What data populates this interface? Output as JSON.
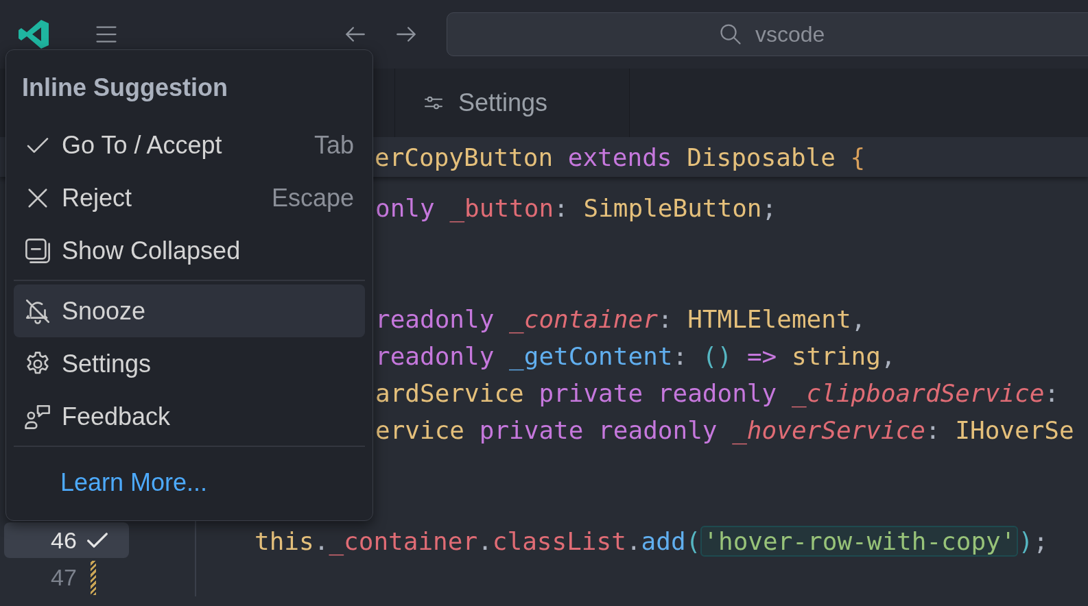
{
  "titlebar": {
    "command_center": "vscode"
  },
  "tabs": [
    {
      "label": "Settings",
      "selected": false
    }
  ],
  "editor": {
    "sticky": {
      "tokens": [
        {
          "text": "erCopyButton",
          "kind": "type"
        },
        {
          "text": " extends",
          "kind": "keyword"
        },
        {
          "text": " Disposable",
          "kind": "type"
        },
        {
          "text": " {",
          "kind": "brace"
        }
      ]
    },
    "lines": [
      {
        "kind": "covered",
        "tokens": [
          {
            "text": "only",
            "kind": "keyword"
          },
          {
            "text": " _button",
            "kind": "variable"
          },
          {
            "text": ": ",
            "kind": "punct"
          },
          {
            "text": "SimpleButton",
            "kind": "type"
          },
          {
            "text": ";",
            "kind": "punct"
          }
        ]
      },
      {
        "kind": "blank"
      },
      {
        "kind": "blank"
      },
      {
        "kind": "covered",
        "tokens": [
          {
            "text": "readonly",
            "kind": "keyword"
          },
          {
            "text": " _container",
            "kind": "parameter"
          },
          {
            "text": ": ",
            "kind": "punct"
          },
          {
            "text": "HTMLElement",
            "kind": "type"
          },
          {
            "text": ",",
            "kind": "punct"
          }
        ]
      },
      {
        "kind": "covered",
        "tokens": [
          {
            "text": "readonly",
            "kind": "keyword"
          },
          {
            "text": " _getContent",
            "kind": "function"
          },
          {
            "text": ": ",
            "kind": "punct"
          },
          {
            "text": "()",
            "kind": "paren"
          },
          {
            "text": " =>",
            "kind": "keyword"
          },
          {
            "text": " string",
            "kind": "type"
          },
          {
            "text": ",",
            "kind": "punct"
          }
        ]
      },
      {
        "kind": "covered",
        "tokens": [
          {
            "text": "ardService",
            "kind": "type"
          },
          {
            "text": " private",
            "kind": "keyword"
          },
          {
            "text": " readonly",
            "kind": "keyword"
          },
          {
            "text": " _clipboardService",
            "kind": "parameter"
          },
          {
            "text": ":",
            "kind": "punct"
          }
        ]
      },
      {
        "kind": "covered",
        "tokens": [
          {
            "text": "ervice",
            "kind": "type"
          },
          {
            "text": " private",
            "kind": "keyword"
          },
          {
            "text": " readonly",
            "kind": "keyword"
          },
          {
            "text": " _hoverService",
            "kind": "parameter"
          },
          {
            "text": ": ",
            "kind": "punct"
          },
          {
            "text": "IHoverSe",
            "kind": "type"
          }
        ]
      },
      {
        "kind": "blank"
      },
      {
        "kind": "blank"
      },
      {
        "kind": "full",
        "number": "46",
        "current": true,
        "modified": false,
        "tokens": [
          {
            "text": "this",
            "kind": "type"
          },
          {
            "text": ".",
            "kind": "punct"
          },
          {
            "text": "_container",
            "kind": "variable"
          },
          {
            "text": ".",
            "kind": "punct"
          },
          {
            "text": "classList",
            "kind": "variable"
          },
          {
            "text": ".",
            "kind": "punct"
          },
          {
            "text": "add",
            "kind": "function"
          },
          {
            "text": "(",
            "kind": "paren"
          },
          {
            "text": "'hover-row-with-copy'",
            "kind": "matched-string"
          },
          {
            "text": ")",
            "kind": "paren"
          },
          {
            "text": ";",
            "kind": "punct"
          }
        ]
      },
      {
        "kind": "full",
        "number": "47",
        "current": false,
        "modified": true
      }
    ]
  },
  "menu": {
    "title": "Inline Suggestion",
    "items": [
      {
        "kind": "item",
        "label": "Go To / Accept",
        "shortcut": "Tab",
        "selected": false
      },
      {
        "kind": "item",
        "label": "Reject",
        "shortcut": "Escape",
        "selected": false
      },
      {
        "kind": "item",
        "label": "Show Collapsed",
        "selected": false
      },
      {
        "kind": "separator"
      },
      {
        "kind": "item",
        "label": "Snooze",
        "selected": true
      },
      {
        "kind": "item",
        "label": "Settings",
        "selected": false
      },
      {
        "kind": "item",
        "label": "Feedback",
        "selected": false
      },
      {
        "kind": "separator"
      },
      {
        "kind": "link",
        "label": "Learn More..."
      }
    ]
  }
}
